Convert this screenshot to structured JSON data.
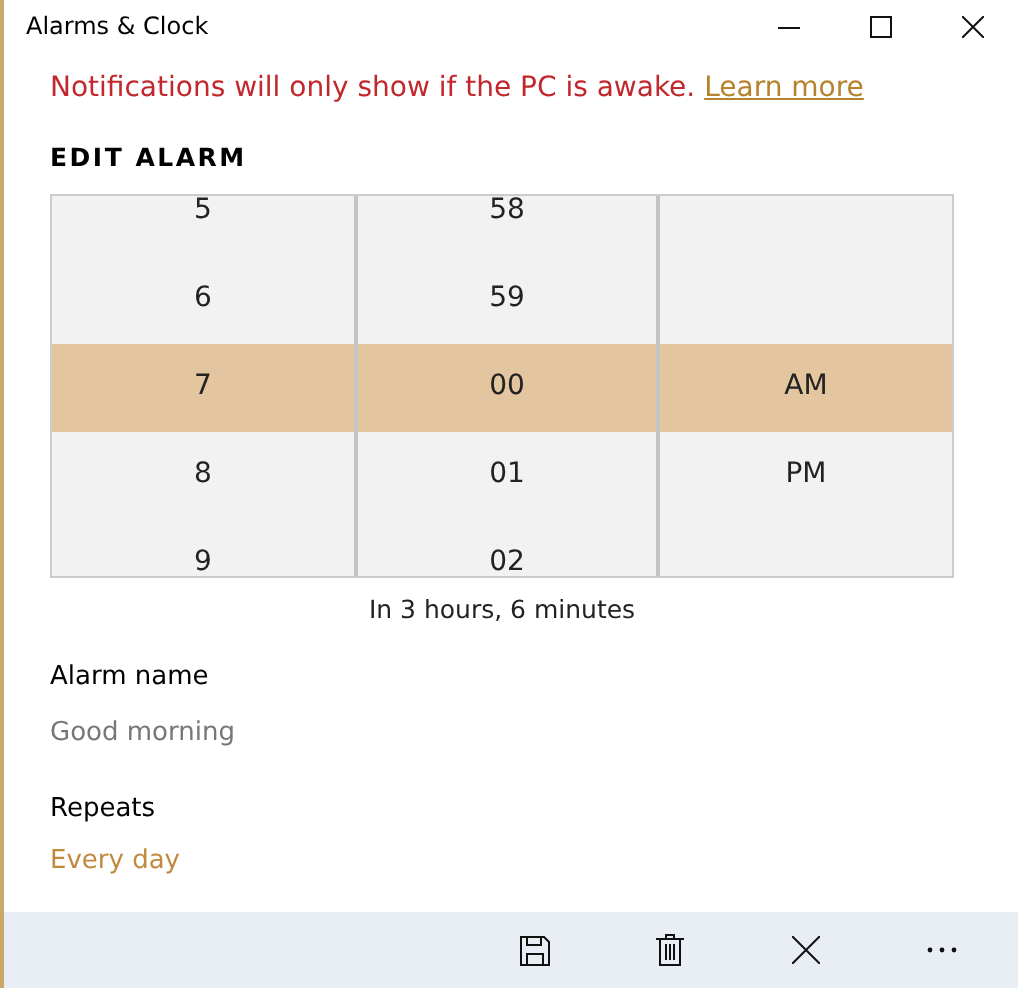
{
  "window": {
    "title": "Alarms & Clock"
  },
  "notice": {
    "text": "Notifications will only show if the PC is awake.",
    "link": "Learn more"
  },
  "heading": "EDIT ALARM",
  "picker": {
    "columns": [
      {
        "kind": "hour",
        "items": [
          {
            "label": "5",
            "selected": false
          },
          {
            "label": "6",
            "selected": false
          },
          {
            "label": "7",
            "selected": true
          },
          {
            "label": "8",
            "selected": false
          },
          {
            "label": "9",
            "selected": false
          }
        ]
      },
      {
        "kind": "minute",
        "items": [
          {
            "label": "58",
            "selected": false
          },
          {
            "label": "59",
            "selected": false
          },
          {
            "label": "00",
            "selected": true
          },
          {
            "label": "01",
            "selected": false
          },
          {
            "label": "02",
            "selected": false
          }
        ]
      },
      {
        "kind": "period",
        "items": [
          {
            "label": "AM",
            "selected": true
          },
          {
            "label": "PM",
            "selected": false
          }
        ]
      }
    ]
  },
  "countdown": "In 3 hours, 6 minutes",
  "alarm_name": {
    "label": "Alarm name",
    "placeholder": "Good morning"
  },
  "repeats": {
    "label": "Repeats",
    "value": "Every day"
  },
  "command_bar": [
    {
      "kind": "save"
    },
    {
      "kind": "delete"
    },
    {
      "kind": "close"
    },
    {
      "kind": "more"
    }
  ]
}
